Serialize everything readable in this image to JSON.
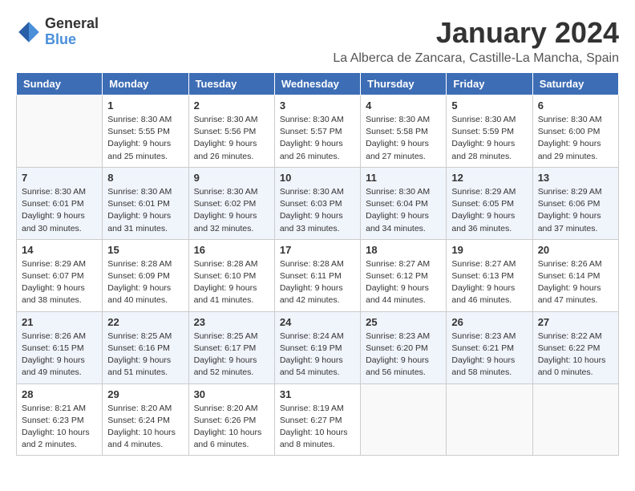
{
  "logo": {
    "general": "General",
    "blue": "Blue"
  },
  "title": "January 2024",
  "location": "La Alberca de Zancara, Castille-La Mancha, Spain",
  "days_of_week": [
    "Sunday",
    "Monday",
    "Tuesday",
    "Wednesday",
    "Thursday",
    "Friday",
    "Saturday"
  ],
  "weeks": [
    [
      {
        "day": "",
        "info": ""
      },
      {
        "day": "1",
        "info": "Sunrise: 8:30 AM\nSunset: 5:55 PM\nDaylight: 9 hours\nand 25 minutes."
      },
      {
        "day": "2",
        "info": "Sunrise: 8:30 AM\nSunset: 5:56 PM\nDaylight: 9 hours\nand 26 minutes."
      },
      {
        "day": "3",
        "info": "Sunrise: 8:30 AM\nSunset: 5:57 PM\nDaylight: 9 hours\nand 26 minutes."
      },
      {
        "day": "4",
        "info": "Sunrise: 8:30 AM\nSunset: 5:58 PM\nDaylight: 9 hours\nand 27 minutes."
      },
      {
        "day": "5",
        "info": "Sunrise: 8:30 AM\nSunset: 5:59 PM\nDaylight: 9 hours\nand 28 minutes."
      },
      {
        "day": "6",
        "info": "Sunrise: 8:30 AM\nSunset: 6:00 PM\nDaylight: 9 hours\nand 29 minutes."
      }
    ],
    [
      {
        "day": "7",
        "info": "Sunrise: 8:30 AM\nSunset: 6:01 PM\nDaylight: 9 hours\nand 30 minutes."
      },
      {
        "day": "8",
        "info": "Sunrise: 8:30 AM\nSunset: 6:01 PM\nDaylight: 9 hours\nand 31 minutes."
      },
      {
        "day": "9",
        "info": "Sunrise: 8:30 AM\nSunset: 6:02 PM\nDaylight: 9 hours\nand 32 minutes."
      },
      {
        "day": "10",
        "info": "Sunrise: 8:30 AM\nSunset: 6:03 PM\nDaylight: 9 hours\nand 33 minutes."
      },
      {
        "day": "11",
        "info": "Sunrise: 8:30 AM\nSunset: 6:04 PM\nDaylight: 9 hours\nand 34 minutes."
      },
      {
        "day": "12",
        "info": "Sunrise: 8:29 AM\nSunset: 6:05 PM\nDaylight: 9 hours\nand 36 minutes."
      },
      {
        "day": "13",
        "info": "Sunrise: 8:29 AM\nSunset: 6:06 PM\nDaylight: 9 hours\nand 37 minutes."
      }
    ],
    [
      {
        "day": "14",
        "info": "Sunrise: 8:29 AM\nSunset: 6:07 PM\nDaylight: 9 hours\nand 38 minutes."
      },
      {
        "day": "15",
        "info": "Sunrise: 8:28 AM\nSunset: 6:09 PM\nDaylight: 9 hours\nand 40 minutes."
      },
      {
        "day": "16",
        "info": "Sunrise: 8:28 AM\nSunset: 6:10 PM\nDaylight: 9 hours\nand 41 minutes."
      },
      {
        "day": "17",
        "info": "Sunrise: 8:28 AM\nSunset: 6:11 PM\nDaylight: 9 hours\nand 42 minutes."
      },
      {
        "day": "18",
        "info": "Sunrise: 8:27 AM\nSunset: 6:12 PM\nDaylight: 9 hours\nand 44 minutes."
      },
      {
        "day": "19",
        "info": "Sunrise: 8:27 AM\nSunset: 6:13 PM\nDaylight: 9 hours\nand 46 minutes."
      },
      {
        "day": "20",
        "info": "Sunrise: 8:26 AM\nSunset: 6:14 PM\nDaylight: 9 hours\nand 47 minutes."
      }
    ],
    [
      {
        "day": "21",
        "info": "Sunrise: 8:26 AM\nSunset: 6:15 PM\nDaylight: 9 hours\nand 49 minutes."
      },
      {
        "day": "22",
        "info": "Sunrise: 8:25 AM\nSunset: 6:16 PM\nDaylight: 9 hours\nand 51 minutes."
      },
      {
        "day": "23",
        "info": "Sunrise: 8:25 AM\nSunset: 6:17 PM\nDaylight: 9 hours\nand 52 minutes."
      },
      {
        "day": "24",
        "info": "Sunrise: 8:24 AM\nSunset: 6:19 PM\nDaylight: 9 hours\nand 54 minutes."
      },
      {
        "day": "25",
        "info": "Sunrise: 8:23 AM\nSunset: 6:20 PM\nDaylight: 9 hours\nand 56 minutes."
      },
      {
        "day": "26",
        "info": "Sunrise: 8:23 AM\nSunset: 6:21 PM\nDaylight: 9 hours\nand 58 minutes."
      },
      {
        "day": "27",
        "info": "Sunrise: 8:22 AM\nSunset: 6:22 PM\nDaylight: 10 hours\nand 0 minutes."
      }
    ],
    [
      {
        "day": "28",
        "info": "Sunrise: 8:21 AM\nSunset: 6:23 PM\nDaylight: 10 hours\nand 2 minutes."
      },
      {
        "day": "29",
        "info": "Sunrise: 8:20 AM\nSunset: 6:24 PM\nDaylight: 10 hours\nand 4 minutes."
      },
      {
        "day": "30",
        "info": "Sunrise: 8:20 AM\nSunset: 6:26 PM\nDaylight: 10 hours\nand 6 minutes."
      },
      {
        "day": "31",
        "info": "Sunrise: 8:19 AM\nSunset: 6:27 PM\nDaylight: 10 hours\nand 8 minutes."
      },
      {
        "day": "",
        "info": ""
      },
      {
        "day": "",
        "info": ""
      },
      {
        "day": "",
        "info": ""
      }
    ]
  ]
}
